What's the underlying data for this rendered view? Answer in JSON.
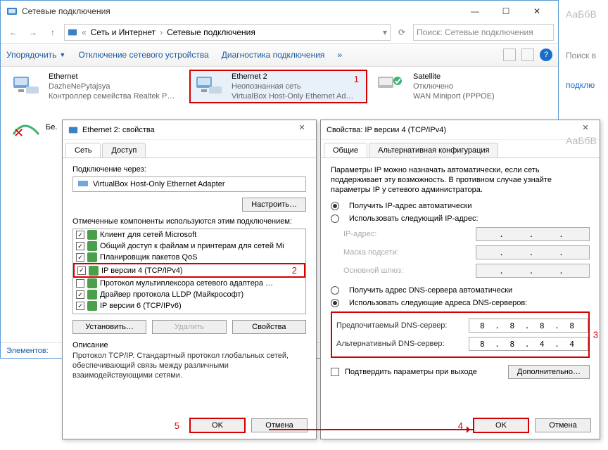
{
  "window": {
    "title": "Сетевые подключения",
    "breadcrumb": [
      "Сеть и Интернет",
      "Сетевые подключения"
    ],
    "search_placeholder": "Поиск: Сетевые подключения",
    "status": "Элементов:"
  },
  "toolbar": {
    "organize": "Упорядочить",
    "disable": "Отключение сетевого устройства",
    "diagnose": "Диагностика подключения"
  },
  "connections": [
    {
      "name": "Ethernet",
      "sub1": "DazheNePytajsya",
      "sub2": "Контроллер семейства Realtek P…"
    },
    {
      "name": "Ethernet 2",
      "sub1": "Неопознанная сеть",
      "sub2": "VirtualBox Host-Only Ethernet Ad…",
      "marker": "1"
    },
    {
      "name": "Satellite",
      "sub1": "Отключено",
      "sub2": "WAN Miniport (PPPOE)"
    },
    {
      "name": "Бе...",
      "sub1": "",
      "sub2": ""
    }
  ],
  "props": {
    "title": "Ethernet 2: свойства",
    "tabs": {
      "net": "Сеть",
      "access": "Доступ"
    },
    "connect_via": "Подключение через:",
    "adapter": "VirtualBox Host-Only Ethernet Adapter",
    "configure": "Настроить…",
    "components_label": "Отмеченные компоненты используются этим подключением:",
    "components": [
      {
        "checked": true,
        "label": "Клиент для сетей Microsoft"
      },
      {
        "checked": true,
        "label": "Общий доступ к файлам и принтерам для сетей Mi"
      },
      {
        "checked": true,
        "label": "Планировщик пакетов QoS"
      },
      {
        "checked": true,
        "label": "IP версии 4 (TCP/IPv4)",
        "highlight": true,
        "marker": "2"
      },
      {
        "checked": false,
        "label": "Протокол мультиплексора сетевого адаптера …"
      },
      {
        "checked": true,
        "label": "Драйвер протокола LLDP (Майкрософт)"
      },
      {
        "checked": true,
        "label": "IP версии 6 (TCP/IPv6)"
      }
    ],
    "install": "Установить…",
    "remove": "Удалить",
    "properties": "Свойства",
    "desc_title": "Описание",
    "desc": "Протокол TCP/IP. Стандартный протокол глобальных сетей, обеспечивающий связь между различными взаимодействующими сетями.",
    "ok": "OK",
    "cancel": "Отмена",
    "marker": "5"
  },
  "ipv4": {
    "title": "Свойства: IP версии 4 (TCP/IPv4)",
    "tabs": {
      "general": "Общие",
      "alt": "Альтернативная конфигурация"
    },
    "intro": "Параметры IP можно назначать автоматически, если сеть поддерживает эту возможность. В противном случае узнайте параметры IP у сетевого администратора.",
    "ip_auto": "Получить IP-адрес автоматически",
    "ip_manual": "Использовать следующий IP-адрес:",
    "ip_addr": "IP-адрес:",
    "mask": "Маска подсети:",
    "gateway": "Основной шлюз:",
    "dns_auto": "Получить адрес DNS-сервера автоматически",
    "dns_manual": "Использовать следующие адреса DNS-серверов:",
    "dns_pref": "Предпочитаемый DNS-сервер:",
    "dns_alt": "Альтернативный DNS-сервер:",
    "dns1": "8 . 8 . 8 . 8",
    "dns2": "8 . 8 . 4 . 4",
    "marker_group": "3",
    "validate": "Подтвердить параметры при выходе",
    "advanced": "Дополнительно…",
    "ok": "OK",
    "cancel": "Отмена",
    "marker": "4"
  },
  "side": {
    "aa": "АаБбВ",
    "search": "Поиск в",
    "link": "подклю"
  }
}
